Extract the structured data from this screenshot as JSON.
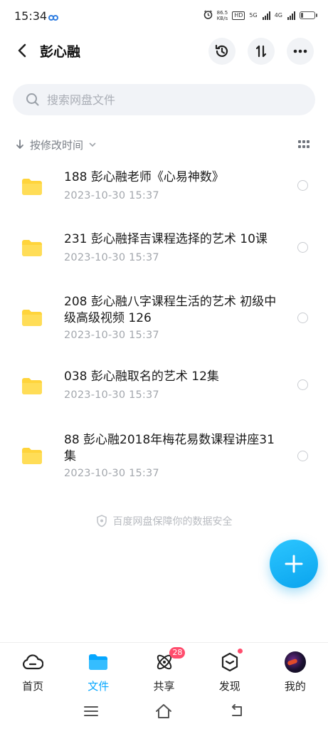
{
  "status_bar": {
    "time": "15:34",
    "net_speed_value": "86.5",
    "net_speed_unit": "KB/s",
    "hd_label": "HD",
    "sim1_label": "5G",
    "sim2_label": "4G",
    "battery_level": 0.2
  },
  "header": {
    "title": "彭心融"
  },
  "search": {
    "placeholder": "搜索网盘文件"
  },
  "sort": {
    "label": "按修改时间"
  },
  "files": [
    {
      "name": "188 彭心融老师《心易神数》",
      "date": "2023-10-30  15:37"
    },
    {
      "name": "231  彭心融择吉课程选择的艺术 10课",
      "date": "2023-10-30  15:37"
    },
    {
      "name": "208 彭心融八字课程生活的艺术 初级中级高级视频 126",
      "date": "2023-10-30  15:37"
    },
    {
      "name": "038 彭心融取名的艺术 12集",
      "date": "2023-10-30  15:37"
    },
    {
      "name": "88 彭心融2018年梅花易数课程讲座31集",
      "date": "2023-10-30  15:37"
    }
  ],
  "security_note": "百度网盘保障你的数据安全",
  "bottom_nav": {
    "items": [
      {
        "label": "首页"
      },
      {
        "label": "文件"
      },
      {
        "label": "共享",
        "badge": "28"
      },
      {
        "label": "发现"
      },
      {
        "label": "我的"
      }
    ],
    "active_index": 1
  },
  "colors": {
    "accent": "#06a7ff",
    "folder": "#ffd43b",
    "badge": "#ff4d6d"
  }
}
